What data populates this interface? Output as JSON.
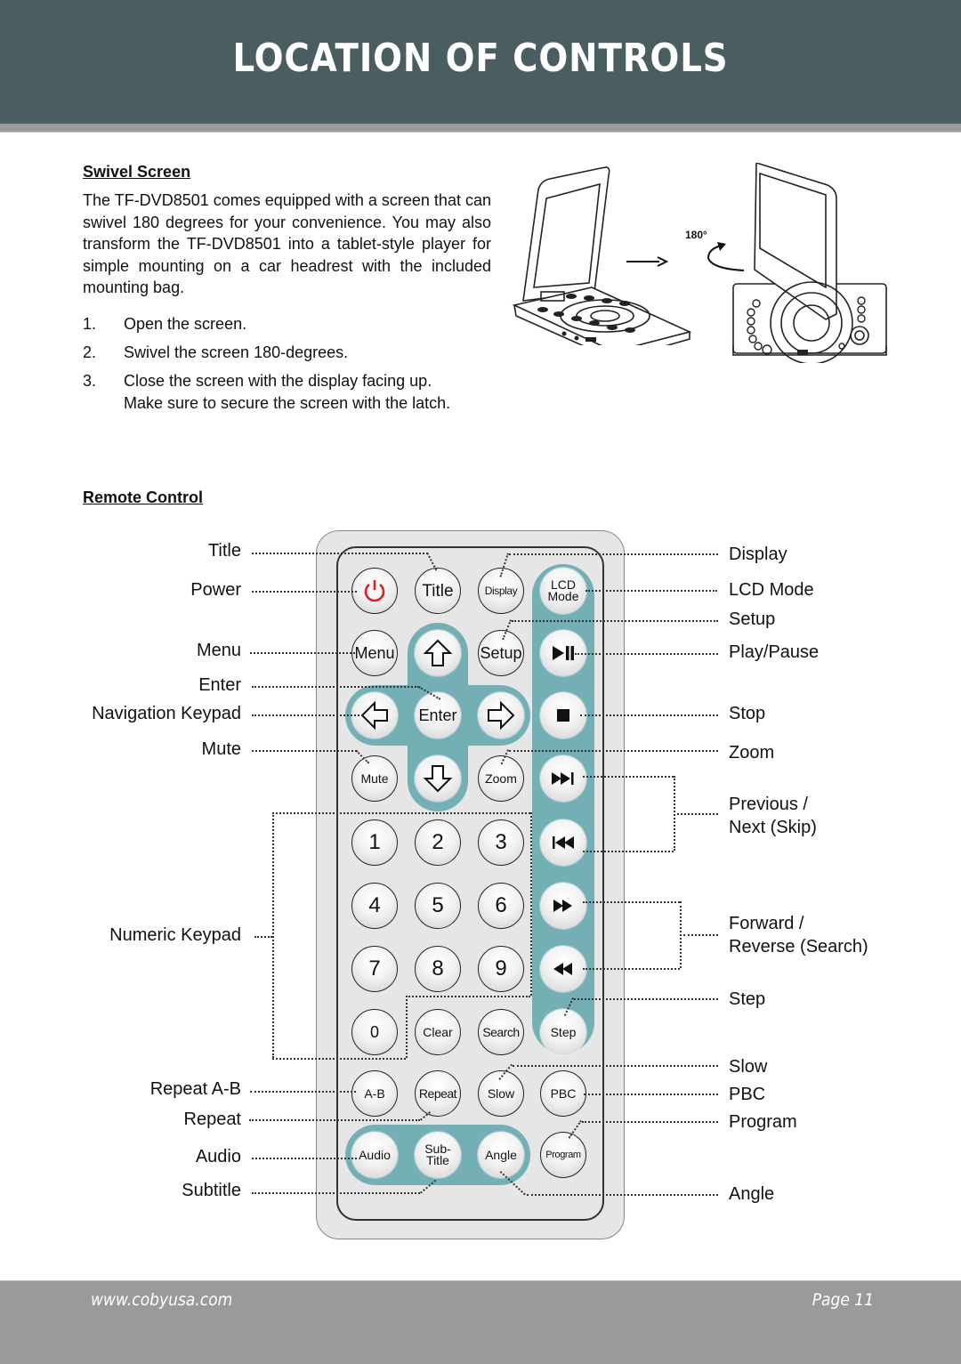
{
  "header": {
    "title": "LOCATION OF CONTROLS"
  },
  "swivel": {
    "title": "Swivel Screen",
    "paragraph": "The TF-DVD8501 comes equipped with a screen that can swivel 180 degrees for your convenience. You may also transform the TF-DVD8501 into a tablet-style player for simple mounting on a car headrest with the included mounting bag.",
    "steps": [
      {
        "num": "1.",
        "text": "Open the screen."
      },
      {
        "num": "2.",
        "text": "Swivel the screen 180-degrees."
      },
      {
        "num": "3.",
        "text": "Close the screen with the display facing up.",
        "text2": "Make sure to secure the screen with the latch."
      }
    ],
    "illustration": {
      "rotation_label": "180°"
    }
  },
  "remote": {
    "title": "Remote Control",
    "buttons": {
      "power": "power-icon",
      "title": "Title",
      "display": "Display",
      "lcd_mode_1": "LCD",
      "lcd_mode_2": "Mode",
      "menu": "Menu",
      "up": "arrow-up-icon",
      "setup": "Setup",
      "play_pause": "play-pause-icon",
      "left": "arrow-left-icon",
      "enter": "Enter",
      "right": "arrow-right-icon",
      "stop": "stop-icon",
      "mute": "Mute",
      "down": "arrow-down-icon",
      "zoom": "Zoom",
      "next": "skip-next-icon",
      "n1": "1",
      "n2": "2",
      "n3": "3",
      "prev": "skip-previous-icon",
      "n4": "4",
      "n5": "5",
      "n6": "6",
      "forward": "fast-forward-icon",
      "n7": "7",
      "n8": "8",
      "n9": "9",
      "reverse": "rewind-icon",
      "n0": "0",
      "clear": "Clear",
      "search": "Search",
      "step": "Step",
      "ab": "A-B",
      "repeat": "Repeat",
      "slow": "Slow",
      "pbc": "PBC",
      "audio": "Audio",
      "subtitle_1": "Sub-",
      "subtitle_2": "Title",
      "angle": "Angle",
      "program": "Program"
    },
    "left_labels": {
      "title": "Title",
      "power": "Power",
      "menu": "Menu",
      "enter": "Enter",
      "navigation": "Navigation Keypad",
      "mute": "Mute",
      "numeric": "Numeric Keypad",
      "repeat_ab": "Repeat A-B",
      "repeat": "Repeat",
      "audio": "Audio",
      "subtitle": "Subtitle"
    },
    "right_labels": {
      "display": "Display",
      "lcd_mode": "LCD Mode",
      "setup": "Setup",
      "play_pause": "Play/Pause",
      "stop": "Stop",
      "zoom": "Zoom",
      "prev_next_1": "Previous /",
      "prev_next_2": "Next (Skip)",
      "fwd_rev_1": "Forward /",
      "fwd_rev_2": "Reverse (Search)",
      "step": "Step",
      "slow": "Slow",
      "pbc": "PBC",
      "program": "Program",
      "angle": "Angle"
    }
  },
  "colors": {
    "header_bg": "#4a5d60",
    "teal": "#74afb6",
    "power_red": "#e02020",
    "footer_bg": "#9a9a9a"
  },
  "footer": {
    "url": "www.cobyusa.com",
    "page": "Page 11"
  }
}
